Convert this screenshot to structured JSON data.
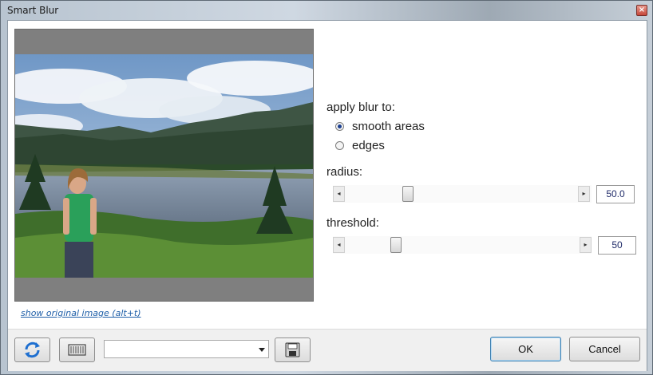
{
  "window": {
    "title": "Smart Blur",
    "close_glyph": "×"
  },
  "preview": {
    "link_text": "show original image (alt+t)"
  },
  "options": {
    "apply_blur_label": "apply blur to:",
    "radio_smooth_label": "smooth areas",
    "radio_edges_label": "edges",
    "selected": "smooth areas",
    "radius_label": "radius:",
    "radius_value": "50.0",
    "threshold_label": "threshold:",
    "threshold_value": "50",
    "left_arrow": "◂",
    "right_arrow": "▸"
  },
  "footer": {
    "preset_value": "",
    "ok_label": "OK",
    "cancel_label": "Cancel",
    "icons": [
      "refresh-icon",
      "keyboard-icon",
      "save-icon"
    ]
  },
  "colors": {
    "accent_blue": "#1b3f8f",
    "link_blue": "#1f5fa8",
    "value_text": "#1f2a68"
  }
}
